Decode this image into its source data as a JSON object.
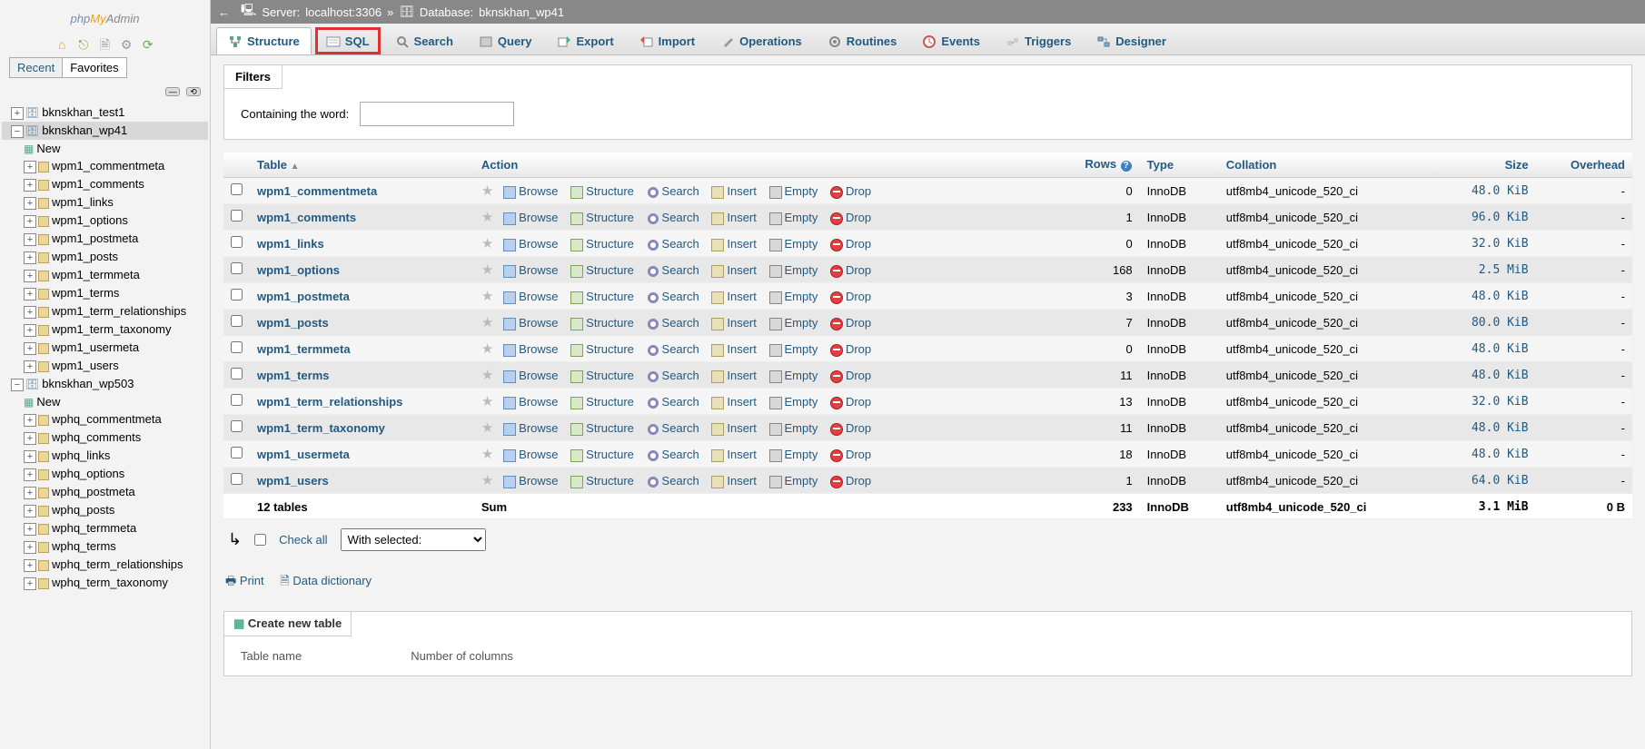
{
  "breadcrumb": {
    "server_label": "Server:",
    "server": "localhost:3306",
    "database_label": "Database:",
    "database": "bknskhan_wp41"
  },
  "sidebar": {
    "recent": "Recent",
    "favorites": "Favorites",
    "dbs": [
      {
        "name": "bknskhan_test1",
        "expanded": false
      },
      {
        "name": "bknskhan_wp41",
        "expanded": true,
        "selected": true,
        "tables": [
          "wpm1_commentmeta",
          "wpm1_comments",
          "wpm1_links",
          "wpm1_options",
          "wpm1_postmeta",
          "wpm1_posts",
          "wpm1_termmeta",
          "wpm1_terms",
          "wpm1_term_relationships",
          "wpm1_term_taxonomy",
          "wpm1_usermeta",
          "wpm1_users"
        ]
      },
      {
        "name": "bknskhan_wp503",
        "expanded": true,
        "tables": [
          "wphq_commentmeta",
          "wphq_comments",
          "wphq_links",
          "wphq_options",
          "wphq_postmeta",
          "wphq_posts",
          "wphq_termmeta",
          "wphq_terms",
          "wphq_term_relationships",
          "wphq_term_taxonomy"
        ]
      }
    ],
    "new": "New"
  },
  "tabs": {
    "structure": "Structure",
    "sql": "SQL",
    "search": "Search",
    "query": "Query",
    "export": "Export",
    "import": "Import",
    "operations": "Operations",
    "routines": "Routines",
    "events": "Events",
    "triggers": "Triggers",
    "designer": "Designer"
  },
  "filters": {
    "title": "Filters",
    "containing": "Containing the word:"
  },
  "headers": {
    "table": "Table",
    "action": "Action",
    "rows": "Rows",
    "type": "Type",
    "collation": "Collation",
    "size": "Size",
    "overhead": "Overhead"
  },
  "actions": {
    "browse": "Browse",
    "structure": "Structure",
    "search": "Search",
    "insert": "Insert",
    "empty": "Empty",
    "drop": "Drop"
  },
  "tables": [
    {
      "name": "wpm1_commentmeta",
      "rows": 0,
      "type": "InnoDB",
      "collation": "utf8mb4_unicode_520_ci",
      "size": "48.0 KiB",
      "overhead": "-"
    },
    {
      "name": "wpm1_comments",
      "rows": 1,
      "type": "InnoDB",
      "collation": "utf8mb4_unicode_520_ci",
      "size": "96.0 KiB",
      "overhead": "-"
    },
    {
      "name": "wpm1_links",
      "rows": 0,
      "type": "InnoDB",
      "collation": "utf8mb4_unicode_520_ci",
      "size": "32.0 KiB",
      "overhead": "-"
    },
    {
      "name": "wpm1_options",
      "rows": 168,
      "type": "InnoDB",
      "collation": "utf8mb4_unicode_520_ci",
      "size": "2.5 MiB",
      "overhead": "-"
    },
    {
      "name": "wpm1_postmeta",
      "rows": 3,
      "type": "InnoDB",
      "collation": "utf8mb4_unicode_520_ci",
      "size": "48.0 KiB",
      "overhead": "-"
    },
    {
      "name": "wpm1_posts",
      "rows": 7,
      "type": "InnoDB",
      "collation": "utf8mb4_unicode_520_ci",
      "size": "80.0 KiB",
      "overhead": "-"
    },
    {
      "name": "wpm1_termmeta",
      "rows": 0,
      "type": "InnoDB",
      "collation": "utf8mb4_unicode_520_ci",
      "size": "48.0 KiB",
      "overhead": "-"
    },
    {
      "name": "wpm1_terms",
      "rows": 11,
      "type": "InnoDB",
      "collation": "utf8mb4_unicode_520_ci",
      "size": "48.0 KiB",
      "overhead": "-"
    },
    {
      "name": "wpm1_term_relationships",
      "rows": 13,
      "type": "InnoDB",
      "collation": "utf8mb4_unicode_520_ci",
      "size": "32.0 KiB",
      "overhead": "-"
    },
    {
      "name": "wpm1_term_taxonomy",
      "rows": 11,
      "type": "InnoDB",
      "collation": "utf8mb4_unicode_520_ci",
      "size": "48.0 KiB",
      "overhead": "-"
    },
    {
      "name": "wpm1_usermeta",
      "rows": 18,
      "type": "InnoDB",
      "collation": "utf8mb4_unicode_520_ci",
      "size": "48.0 KiB",
      "overhead": "-"
    },
    {
      "name": "wpm1_users",
      "rows": 1,
      "type": "InnoDB",
      "collation": "utf8mb4_unicode_520_ci",
      "size": "64.0 KiB",
      "overhead": "-"
    }
  ],
  "summary": {
    "count": "12 tables",
    "sum": "Sum",
    "rows": 233,
    "type": "InnoDB",
    "collation": "utf8mb4_unicode_520_ci",
    "size": "3.1 MiB",
    "overhead": "0 B"
  },
  "below": {
    "check_all": "Check all",
    "with_selected": "With selected:"
  },
  "extras": {
    "print": "Print",
    "data_dict": "Data dictionary"
  },
  "create": {
    "title": "Create new table",
    "table_name": "Table name",
    "num_cols": "Number of columns"
  }
}
